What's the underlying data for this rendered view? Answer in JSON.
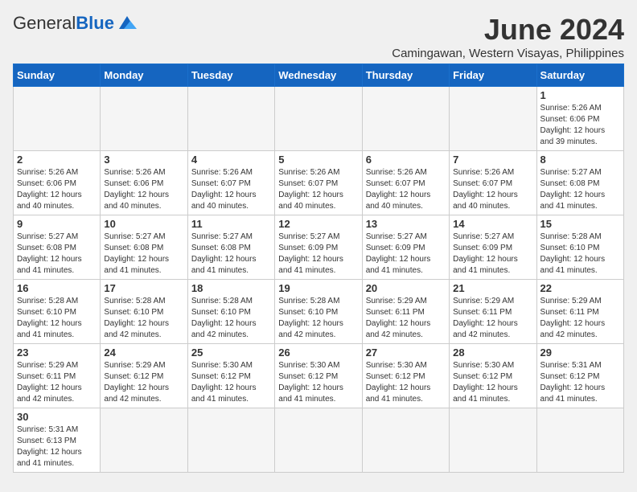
{
  "header": {
    "logo_general": "General",
    "logo_blue": "Blue",
    "title": "June 2024",
    "subtitle": "Camingawan, Western Visayas, Philippines"
  },
  "weekdays": [
    "Sunday",
    "Monday",
    "Tuesday",
    "Wednesday",
    "Thursday",
    "Friday",
    "Saturday"
  ],
  "weeks": [
    [
      {
        "day": "",
        "info": ""
      },
      {
        "day": "",
        "info": ""
      },
      {
        "day": "",
        "info": ""
      },
      {
        "day": "",
        "info": ""
      },
      {
        "day": "",
        "info": ""
      },
      {
        "day": "",
        "info": ""
      },
      {
        "day": "1",
        "info": "Sunrise: 5:26 AM\nSunset: 6:06 PM\nDaylight: 12 hours\nand 39 minutes."
      }
    ],
    [
      {
        "day": "2",
        "info": "Sunrise: 5:26 AM\nSunset: 6:06 PM\nDaylight: 12 hours\nand 40 minutes."
      },
      {
        "day": "3",
        "info": "Sunrise: 5:26 AM\nSunset: 6:06 PM\nDaylight: 12 hours\nand 40 minutes."
      },
      {
        "day": "4",
        "info": "Sunrise: 5:26 AM\nSunset: 6:07 PM\nDaylight: 12 hours\nand 40 minutes."
      },
      {
        "day": "5",
        "info": "Sunrise: 5:26 AM\nSunset: 6:07 PM\nDaylight: 12 hours\nand 40 minutes."
      },
      {
        "day": "6",
        "info": "Sunrise: 5:26 AM\nSunset: 6:07 PM\nDaylight: 12 hours\nand 40 minutes."
      },
      {
        "day": "7",
        "info": "Sunrise: 5:26 AM\nSunset: 6:07 PM\nDaylight: 12 hours\nand 40 minutes."
      },
      {
        "day": "8",
        "info": "Sunrise: 5:27 AM\nSunset: 6:08 PM\nDaylight: 12 hours\nand 41 minutes."
      }
    ],
    [
      {
        "day": "9",
        "info": "Sunrise: 5:27 AM\nSunset: 6:08 PM\nDaylight: 12 hours\nand 41 minutes."
      },
      {
        "day": "10",
        "info": "Sunrise: 5:27 AM\nSunset: 6:08 PM\nDaylight: 12 hours\nand 41 minutes."
      },
      {
        "day": "11",
        "info": "Sunrise: 5:27 AM\nSunset: 6:08 PM\nDaylight: 12 hours\nand 41 minutes."
      },
      {
        "day": "12",
        "info": "Sunrise: 5:27 AM\nSunset: 6:09 PM\nDaylight: 12 hours\nand 41 minutes."
      },
      {
        "day": "13",
        "info": "Sunrise: 5:27 AM\nSunset: 6:09 PM\nDaylight: 12 hours\nand 41 minutes."
      },
      {
        "day": "14",
        "info": "Sunrise: 5:27 AM\nSunset: 6:09 PM\nDaylight: 12 hours\nand 41 minutes."
      },
      {
        "day": "15",
        "info": "Sunrise: 5:28 AM\nSunset: 6:10 PM\nDaylight: 12 hours\nand 41 minutes."
      }
    ],
    [
      {
        "day": "16",
        "info": "Sunrise: 5:28 AM\nSunset: 6:10 PM\nDaylight: 12 hours\nand 41 minutes."
      },
      {
        "day": "17",
        "info": "Sunrise: 5:28 AM\nSunset: 6:10 PM\nDaylight: 12 hours\nand 42 minutes."
      },
      {
        "day": "18",
        "info": "Sunrise: 5:28 AM\nSunset: 6:10 PM\nDaylight: 12 hours\nand 42 minutes."
      },
      {
        "day": "19",
        "info": "Sunrise: 5:28 AM\nSunset: 6:10 PM\nDaylight: 12 hours\nand 42 minutes."
      },
      {
        "day": "20",
        "info": "Sunrise: 5:29 AM\nSunset: 6:11 PM\nDaylight: 12 hours\nand 42 minutes."
      },
      {
        "day": "21",
        "info": "Sunrise: 5:29 AM\nSunset: 6:11 PM\nDaylight: 12 hours\nand 42 minutes."
      },
      {
        "day": "22",
        "info": "Sunrise: 5:29 AM\nSunset: 6:11 PM\nDaylight: 12 hours\nand 42 minutes."
      }
    ],
    [
      {
        "day": "23",
        "info": "Sunrise: 5:29 AM\nSunset: 6:11 PM\nDaylight: 12 hours\nand 42 minutes."
      },
      {
        "day": "24",
        "info": "Sunrise: 5:29 AM\nSunset: 6:12 PM\nDaylight: 12 hours\nand 42 minutes."
      },
      {
        "day": "25",
        "info": "Sunrise: 5:30 AM\nSunset: 6:12 PM\nDaylight: 12 hours\nand 41 minutes."
      },
      {
        "day": "26",
        "info": "Sunrise: 5:30 AM\nSunset: 6:12 PM\nDaylight: 12 hours\nand 41 minutes."
      },
      {
        "day": "27",
        "info": "Sunrise: 5:30 AM\nSunset: 6:12 PM\nDaylight: 12 hours\nand 41 minutes."
      },
      {
        "day": "28",
        "info": "Sunrise: 5:30 AM\nSunset: 6:12 PM\nDaylight: 12 hours\nand 41 minutes."
      },
      {
        "day": "29",
        "info": "Sunrise: 5:31 AM\nSunset: 6:12 PM\nDaylight: 12 hours\nand 41 minutes."
      }
    ],
    [
      {
        "day": "30",
        "info": "Sunrise: 5:31 AM\nSunset: 6:13 PM\nDaylight: 12 hours\nand 41 minutes."
      },
      {
        "day": "",
        "info": ""
      },
      {
        "day": "",
        "info": ""
      },
      {
        "day": "",
        "info": ""
      },
      {
        "day": "",
        "info": ""
      },
      {
        "day": "",
        "info": ""
      },
      {
        "day": "",
        "info": ""
      }
    ]
  ]
}
